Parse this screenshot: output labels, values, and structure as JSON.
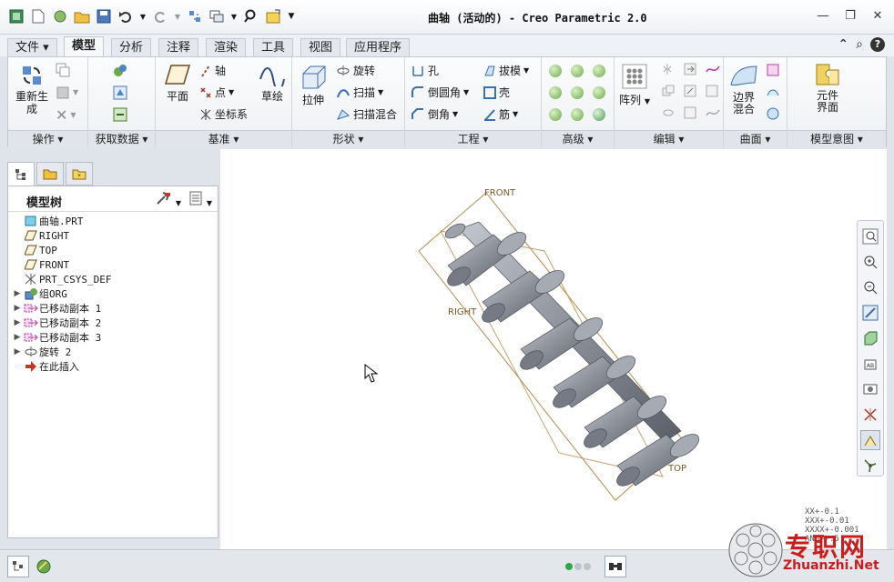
{
  "window": {
    "title": "曲轴 (活动的) - Creo Parametric 2.0",
    "controls": [
      "minimize",
      "restore",
      "close"
    ]
  },
  "menu_tabs": [
    {
      "label": "文件",
      "has_dropdown": true
    },
    {
      "label": "模型",
      "active": true
    },
    {
      "label": "分析"
    },
    {
      "label": "注释"
    },
    {
      "label": "渲染"
    },
    {
      "label": "工具"
    },
    {
      "label": "视图"
    },
    {
      "label": "应用程序"
    }
  ],
  "ribbon": {
    "operations": {
      "label": "操作",
      "regen": "重新生成"
    },
    "get_data": {
      "label": "获取数据"
    },
    "datum": {
      "label": "基准",
      "plane": "平面",
      "axis": "轴",
      "point": "点",
      "csys": "坐标系",
      "sketch": "草绘"
    },
    "shapes": {
      "label": "形状",
      "extrude": "拉伸",
      "revolve": "旋转",
      "sweep": "扫描",
      "swept_blend": "扫描混合"
    },
    "engineering": {
      "label": "工程",
      "hole": "孔",
      "round": "倒圆角",
      "chamfer": "倒角",
      "draft": "拔模",
      "shell": "壳",
      "rib": "筋"
    },
    "advanced": {
      "label": "高级"
    },
    "editing": {
      "label": "编辑",
      "pattern": "阵列"
    },
    "surfaces": {
      "label": "曲面",
      "boundary": "边界混合"
    },
    "model_intent": {
      "label": "模型意图",
      "component": "元件界面"
    }
  },
  "model_tree": {
    "title": "模型树",
    "items": [
      {
        "label": "曲轴.PRT",
        "icon": "part-icon",
        "expandable": false
      },
      {
        "label": "RIGHT",
        "icon": "datum-plane-icon",
        "expandable": false
      },
      {
        "label": "TOP",
        "icon": "datum-plane-icon",
        "expandable": false
      },
      {
        "label": "FRONT",
        "icon": "datum-plane-icon",
        "expandable": false
      },
      {
        "label": "PRT_CSYS_DEF",
        "icon": "csys-icon",
        "expandable": false
      },
      {
        "label": "组ORG",
        "icon": "group-icon",
        "expandable": true
      },
      {
        "label": "已移动副本 1",
        "icon": "moved-copy-icon",
        "expandable": true
      },
      {
        "label": "已移动副本 2",
        "icon": "moved-copy-icon",
        "expandable": true
      },
      {
        "label": "已移动副本 3",
        "icon": "moved-copy-icon",
        "expandable": true
      },
      {
        "label": "旋转 2",
        "icon": "revolve-icon",
        "expandable": true
      },
      {
        "label": "在此插入",
        "icon": "insert-here-icon",
        "expandable": false
      }
    ]
  },
  "viewport": {
    "datum_labels": {
      "front": "FRONT",
      "right": "RIGHT",
      "top": "TOP"
    },
    "coords": [
      "XX+-0.1",
      "XXX+-0.01",
      "XXXX+-0.001",
      "ANG+-.5"
    ]
  },
  "watermark": {
    "text": "专职网",
    "url": "Zhuanzhi.Net"
  },
  "colors": {
    "accent": "#3a76c4",
    "part_gray": "#8c9099",
    "datum_orange": "#b58a48"
  }
}
